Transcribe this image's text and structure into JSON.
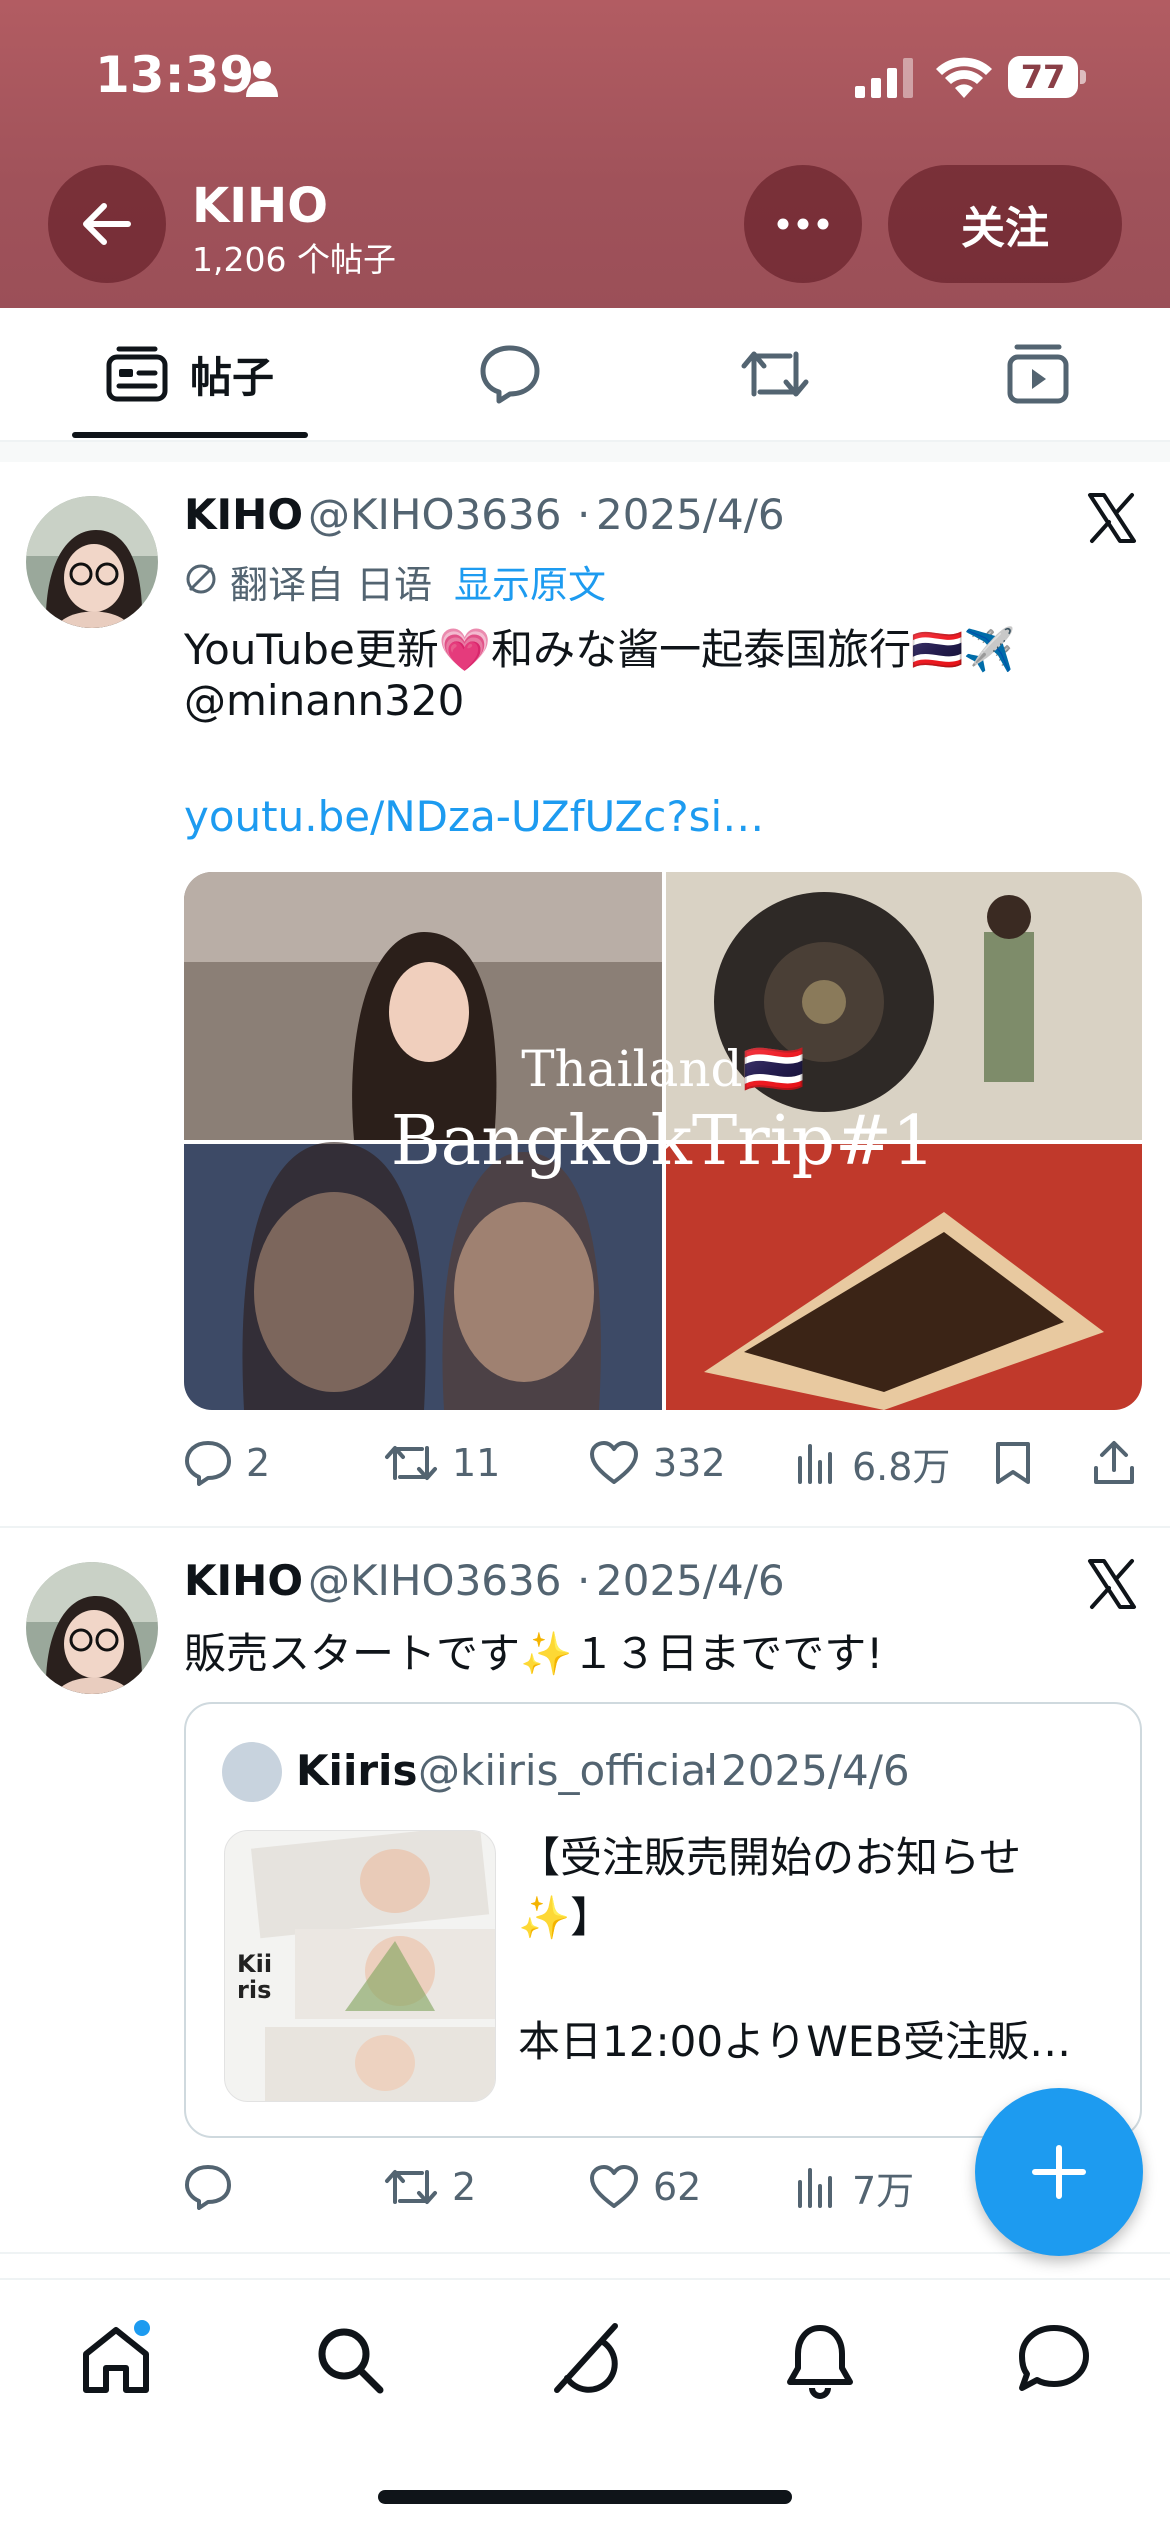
{
  "status_bar": {
    "time": "13:39",
    "battery": "77"
  },
  "header": {
    "title": "KIHO",
    "subtitle": "1,206 个帖子",
    "follow_label": "关注"
  },
  "tabs": [
    {
      "label": "帖子",
      "icon": "posts-icon",
      "active": true
    },
    {
      "label": "",
      "icon": "replies-icon"
    },
    {
      "label": "",
      "icon": "reposts-icon"
    },
    {
      "label": "",
      "icon": "media-icon"
    }
  ],
  "posts": [
    {
      "name": "KIHO",
      "handle": "@KIHO3636",
      "sep": "·",
      "date": "2025/4/6",
      "translated_from": "翻译自 日语",
      "show_original": "显示原文",
      "text_line1": "YouTube更新💗和みな酱一起泰国旅行🇹🇭✈️",
      "text_line2": "@minann320",
      "link": "youtu.be/NDza-UZfUZc?si…",
      "media_text_1": "Thailand🇹🇭",
      "media_text_2": "BangkokTrip#1",
      "replies": "2",
      "reposts": "11",
      "likes": "332",
      "views": "6.8万"
    },
    {
      "name": "KIHO",
      "handle": "@KIHO3636",
      "sep": "·",
      "date": "2025/4/6",
      "text_line1": "販売スタートです✨１３日までです!",
      "quote": {
        "name": "Kiiris",
        "handle": "@kiiris_official",
        "sep": "·",
        "date": "2025/4/6",
        "line1": "【受注販売開始のお知らせ",
        "line2": "✨】",
        "line3": "本日12:00よりWEB受注販…",
        "thumb_text": "Kii ris"
      },
      "replies": "",
      "reposts": "2",
      "likes": "62",
      "views": "7万"
    }
  ],
  "bottom_nav": [
    "home-icon",
    "search-icon",
    "grok-icon",
    "notifications-icon",
    "messages-icon"
  ],
  "colors": {
    "header": "#a0525a",
    "accent": "#1d9bf0",
    "text": "#0f1419",
    "secondary": "#536471"
  }
}
